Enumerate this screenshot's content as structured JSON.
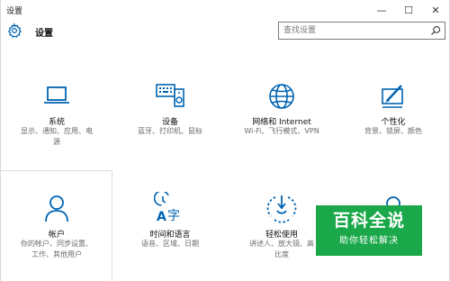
{
  "window": {
    "title": "设置",
    "controls": {
      "minimize": "—",
      "maximize": "☐",
      "close": "✕"
    }
  },
  "header": {
    "app_title": "设置",
    "search_placeholder": "查找设置"
  },
  "tiles": [
    {
      "title": "系统",
      "desc": [
        "显示、通知、应用、电",
        "源"
      ],
      "icon": "laptop-icon"
    },
    {
      "title": "设备",
      "desc": [
        "蓝牙、打印机、鼠标"
      ],
      "icon": "keyboard-speaker-icon"
    },
    {
      "title": "网络和 Internet",
      "desc": [
        "Wi-Fi、飞行模式、VPN"
      ],
      "icon": "globe-icon"
    },
    {
      "title": "个性化",
      "desc": [
        "背景、锁屏、颜色"
      ],
      "icon": "paint-screen-icon"
    },
    {
      "title": "帐户",
      "desc": [
        "你的帐户、同步设置、",
        "工作、其他用户"
      ],
      "icon": "person-icon"
    },
    {
      "title": "时间和语言",
      "desc": [
        "语音、区域、日期"
      ],
      "icon": "time-language-icon"
    },
    {
      "title": "轻松使用",
      "desc": [
        "讲述人、放大镜、高",
        "比度"
      ],
      "icon": "ease-of-access-icon"
    },
    {
      "title": "",
      "desc": [],
      "icon": "partial-icon"
    }
  ],
  "watermark": {
    "main": "百科全说",
    "sub": "助你轻松解决"
  },
  "colors": {
    "accent": "#0063b1",
    "watermark_green": "#1aa84a"
  }
}
